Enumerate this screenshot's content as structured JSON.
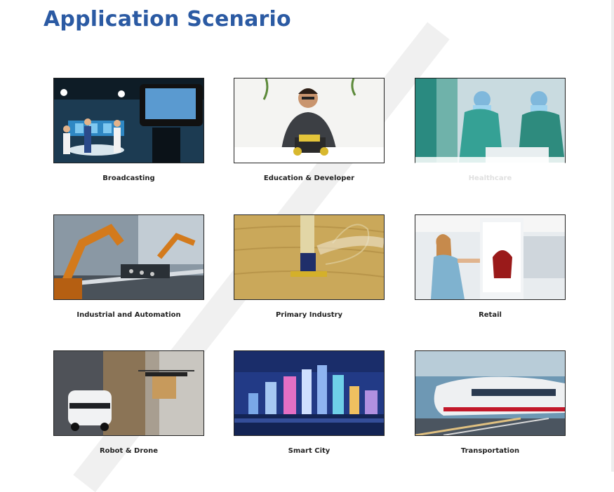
{
  "page": {
    "title": "Application Scenario"
  },
  "scenarios": [
    {
      "label": "Broadcasting",
      "image": "broadcast-studio-image"
    },
    {
      "label": "Education & Developer",
      "image": "developer-robot-image"
    },
    {
      "label": "Healthcare",
      "image": "surgery-room-image"
    },
    {
      "label": "Industrial and Automation",
      "image": "robot-arms-factory-image"
    },
    {
      "label": "Primary Industry",
      "image": "harvester-field-image"
    },
    {
      "label": "Retail",
      "image": "retail-kiosk-image"
    },
    {
      "label": "Robot & Drone",
      "image": "delivery-robot-drone-image"
    },
    {
      "label": "Smart City",
      "image": "city-skyline-night-image"
    },
    {
      "label": "Transportation",
      "image": "high-speed-train-image"
    }
  ],
  "colors": {
    "title": "#2b5aa3",
    "caption": "#222222",
    "caption_faded": "#e0e0e0"
  }
}
